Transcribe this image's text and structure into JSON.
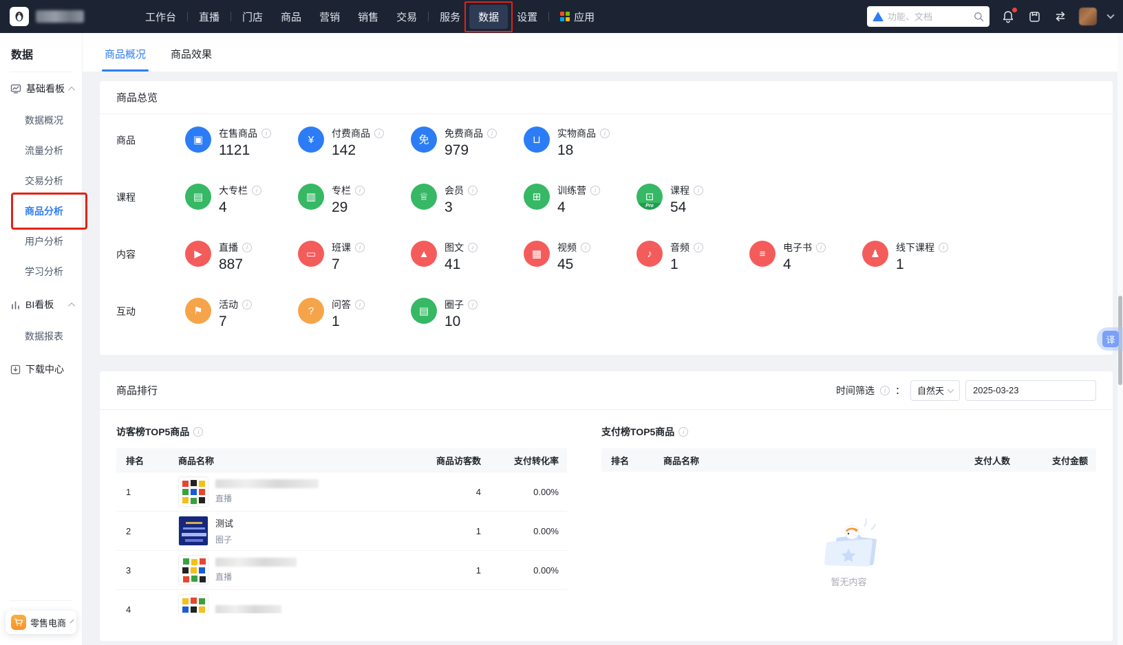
{
  "topnav": {
    "items": [
      {
        "label": "工作台"
      },
      {
        "label": "直播"
      },
      {
        "label": "门店"
      },
      {
        "label": "商品"
      },
      {
        "label": "营销"
      },
      {
        "label": "销售"
      },
      {
        "label": "交易"
      },
      {
        "label": "服务"
      },
      {
        "label": "数据",
        "active": true,
        "annotated": true
      },
      {
        "label": "设置"
      },
      {
        "label": "应用"
      }
    ],
    "search_placeholder": "功能、文档"
  },
  "sidebar": {
    "title": "数据",
    "groups": [
      {
        "label": "基础看板",
        "children": [
          {
            "label": "数据概况"
          },
          {
            "label": "流量分析"
          },
          {
            "label": "交易分析"
          },
          {
            "label": "商品分析",
            "active": true,
            "annotated": true
          },
          {
            "label": "用户分析"
          },
          {
            "label": "学习分析"
          }
        ]
      },
      {
        "label": "BI看板",
        "children": [
          {
            "label": "数据报表"
          }
        ]
      }
    ],
    "download_center": "下载中心",
    "workspace": "零售电商"
  },
  "tabs": [
    {
      "label": "商品概况",
      "active": true
    },
    {
      "label": "商品效果"
    }
  ],
  "overview": {
    "title": "商品总览",
    "rows": [
      {
        "label": "商品",
        "color": "#2c7df5",
        "items": [
          {
            "label": "在售商品",
            "value": "1121",
            "glyph": "▣"
          },
          {
            "label": "付费商品",
            "value": "142",
            "glyph": "¥"
          },
          {
            "label": "免费商品",
            "value": "979",
            "glyph": "免"
          },
          {
            "label": "实物商品",
            "value": "18",
            "glyph": "⊔"
          }
        ]
      },
      {
        "label": "课程",
        "color": "#36b865",
        "items": [
          {
            "label": "大专栏",
            "value": "4",
            "glyph": "▤"
          },
          {
            "label": "专栏",
            "value": "29",
            "glyph": "▥"
          },
          {
            "label": "会员",
            "value": "3",
            "glyph": "♕"
          },
          {
            "label": "训练营",
            "value": "4",
            "glyph": "⊞"
          },
          {
            "label": "课程",
            "value": "54",
            "glyph": "⊡",
            "badge": "Pro"
          }
        ]
      },
      {
        "label": "内容",
        "color": "#f45c5b",
        "items": [
          {
            "label": "直播",
            "value": "887",
            "glyph": "▶"
          },
          {
            "label": "班课",
            "value": "7",
            "glyph": "▭"
          },
          {
            "label": "图文",
            "value": "41",
            "glyph": "▲"
          },
          {
            "label": "视频",
            "value": "45",
            "glyph": "▦"
          },
          {
            "label": "音频",
            "value": "1",
            "glyph": "♪"
          },
          {
            "label": "电子书",
            "value": "4",
            "glyph": "≡"
          },
          {
            "label": "线下课程",
            "value": "1",
            "glyph": "♟"
          }
        ]
      },
      {
        "label": "互动",
        "color": "#f6a44a",
        "items": [
          {
            "label": "活动",
            "value": "7",
            "glyph": "⚑",
            "color": "orange"
          },
          {
            "label": "问答",
            "value": "1",
            "glyph": "?",
            "color": "orange"
          },
          {
            "label": "圈子",
            "value": "10",
            "glyph": "▤",
            "color": "green"
          }
        ]
      }
    ]
  },
  "ranking": {
    "title": "商品排行",
    "filter_label": "时间筛选",
    "filter_colon": "：",
    "granularity": "自然天",
    "date": "2025-03-23",
    "visitor_table": {
      "title": "访客榜TOP5商品",
      "columns": [
        "排名",
        "商品名称",
        "商品访客数",
        "支付转化率"
      ],
      "rows": [
        {
          "rank": "1",
          "name": "",
          "name_redacted": true,
          "type": "直播",
          "visitors": "4",
          "conversion": "0.00%"
        },
        {
          "rank": "2",
          "name": "测试",
          "name_redacted": false,
          "type": "圈子",
          "visitors": "1",
          "conversion": "0.00%"
        },
        {
          "rank": "3",
          "name": "",
          "name_redacted": true,
          "type": "直播",
          "visitors": "1",
          "conversion": "0.00%"
        },
        {
          "rank": "4",
          "name": "",
          "name_redacted": true,
          "type": "",
          "visitors": "",
          "conversion": ""
        }
      ]
    },
    "payment_table": {
      "title": "支付榜TOP5商品",
      "columns": [
        "排名",
        "商品名称",
        "支付人数",
        "支付金额"
      ],
      "empty_text": "暂无内容"
    }
  },
  "floating": {
    "translate_label": "译"
  },
  "palette": {
    "nav_bg": "#1c2434",
    "accent_blue": "#2e7cf6",
    "green": "#36b865",
    "red": "#f45c5b",
    "orange": "#f6a44a",
    "annotation_red": "#e12417",
    "page_bg": "#f0f2f5"
  }
}
